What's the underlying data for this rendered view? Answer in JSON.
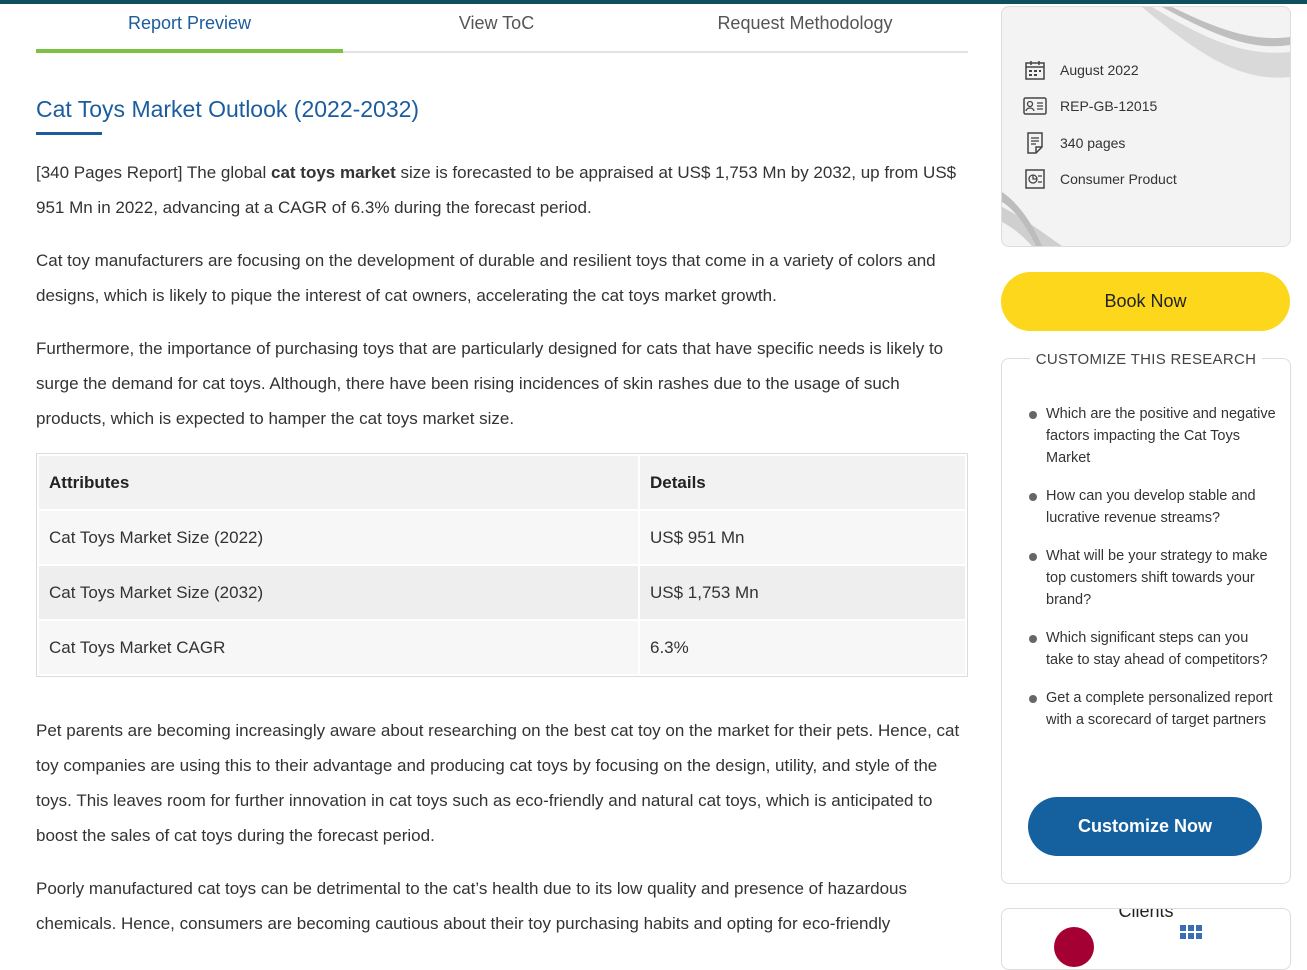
{
  "tabs": [
    {
      "label": "Report Preview",
      "active": true
    },
    {
      "label": "View ToC",
      "active": false
    },
    {
      "label": "Request Methodology",
      "active": false
    }
  ],
  "report": {
    "title": "Cat Toys Market Outlook (2022-2032)",
    "intro": {
      "prefix": "[340 Pages Report] The global ",
      "bold": "cat toys market",
      "suffix": " size is forecasted to be appraised at US$ 1,753 Mn by 2032, up from US$ 951 Mn in 2022, advancing at a CAGR of 6.3% during the forecast period."
    },
    "paragraph2": "Cat toy manufacturers are focusing on the development of durable and resilient toys that come in a variety of colors and designs, which is likely to pique the interest of cat owners, accelerating the cat toys market growth.",
    "paragraph3": "Furthermore, the importance of purchasing toys that are particularly designed for cats that have specific needs is likely to surge the demand for cat toys. Although, there have been rising incidences of skin rashes due to the usage of such products, which is expected to hamper the cat toys market size.",
    "paragraph4": "Pet parents are becoming increasingly aware about researching on the best cat toy on the market for their pets. Hence, cat toy companies are using this to their advantage and producing cat toys by focusing on the design, utility, and style of the toys. This leaves room for further innovation in cat toys such as eco-friendly and natural cat toys, which is anticipated to boost the sales of cat toys during the forecast period.",
    "paragraph5": "Poorly manufactured cat toys can be detrimental to the cat’s health due to its low quality and presence of hazardous chemicals. Hence, consumers are becoming cautious about their toy purchasing habits and opting for eco-friendly"
  },
  "table": {
    "headers": [
      "Attributes",
      "Details"
    ],
    "rows": [
      [
        "Cat Toys Market Size (2022)",
        "US$ 951 Mn"
      ],
      [
        "Cat Toys Market Size (2032)",
        "US$ 1,753 Mn"
      ],
      [
        "Cat Toys Market CAGR",
        "6.3%"
      ]
    ]
  },
  "info": {
    "date": "August 2022",
    "report_id": "REP-GB-12015",
    "pages": "340 pages",
    "category": "Consumer Product",
    "icons": [
      "calendar-icon",
      "id-card-icon",
      "document-icon",
      "category-icon"
    ]
  },
  "book_label": "Book Now",
  "customize": {
    "heading": "CUSTOMIZE THIS RESEARCH",
    "items": [
      "Which are the positive and negative factors impacting the Cat Toys Market",
      "How can you develop stable and lucrative revenue streams?",
      "What will be your strategy to make top customers shift towards your brand?",
      "Which significant steps can you take to stay ahead of competitors?",
      "Get a complete personalized report with a scorecard of target partners"
    ],
    "button_label": "Customize Now"
  },
  "clients_title": "Clients",
  "colors": {
    "accent_blue": "#1b5c9e",
    "tab_active_underline": "#7bc243",
    "book_button": "#fdd71b",
    "customize_button": "#15609f"
  }
}
